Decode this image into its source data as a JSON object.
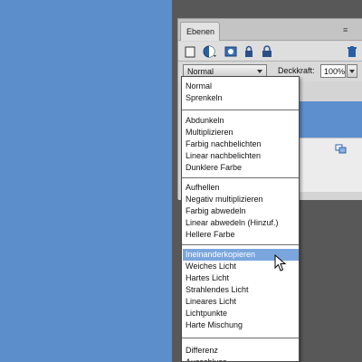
{
  "panel": {
    "tab_label": "Ebenen",
    "menu_glyph": "≡",
    "toolbar_icons": [
      "new-layer-icon",
      "adjustment-layer-icon",
      "mask-icon",
      "lock-icon",
      "lock-all-icon",
      "trash-icon"
    ]
  },
  "controls": {
    "blend_mode": "Normal",
    "opacity_label": "Deckkraft:",
    "opacity_value": "100%"
  },
  "blend_menu": {
    "groups": [
      [
        "Normal",
        "Sprenkeln"
      ],
      [
        "Abdunkeln",
        "Multiplizieren",
        "Farbig nachbelichten",
        "Linear nachbelichten",
        "Dunklere Farbe"
      ],
      [
        "Aufhellen",
        "Negativ multiplizieren",
        "Farbig abwedeln",
        "Linear abwedeln (Hinzuf.)",
        "Hellere Farbe"
      ],
      [
        "Ineinanderkopieren",
        "Weiches Licht",
        "Hartes Licht",
        "Strahlendes Licht",
        "Lineares Licht",
        "Lichtpunkte",
        "Harte Mischung"
      ],
      [
        "Differenz",
        "Ausschluss"
      ]
    ],
    "highlighted": "Ineinanderkopieren"
  },
  "colors": {
    "canvas": "#5b8ecb",
    "workspace": "#585858",
    "selection": "#7aa6dd",
    "active_layer": "#5d8fcf"
  }
}
